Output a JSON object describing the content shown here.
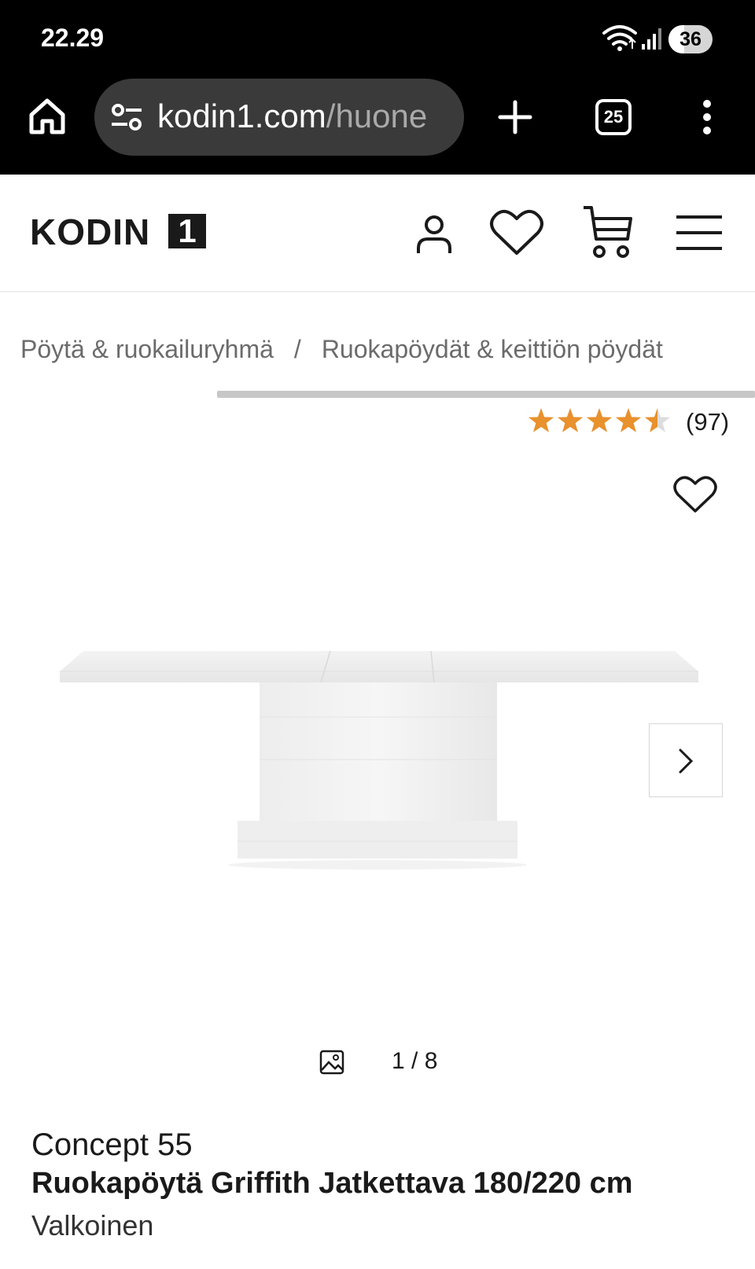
{
  "status_bar": {
    "time": "22.29",
    "battery": "36",
    "battery_level": 0.36
  },
  "browser": {
    "url_domain": "kodin1.com",
    "url_path": "/huone",
    "tab_count": "25"
  },
  "site": {
    "logo_text": "KODIN",
    "logo_number": "1"
  },
  "breadcrumb": {
    "items": [
      "Pöytä & ruokailuryhmä",
      "Ruokapöydät & keittiön pöydät"
    ],
    "separator": "/"
  },
  "rating": {
    "value": 4.5,
    "max": 5,
    "count": "(97)",
    "star_color": "#e8912d"
  },
  "gallery": {
    "counter": "1 / 8"
  },
  "product": {
    "brand": "Concept 55",
    "title": "Ruokapöytä Griffith Jatkettava 180/220 cm",
    "variant": "Valkoinen"
  },
  "icons": [
    "home-icon",
    "tune-icon",
    "plus-icon",
    "tabs-icon",
    "more-vert-icon",
    "user-icon",
    "heart-icon",
    "cart-icon",
    "menu-icon",
    "star-icon",
    "chevron-right-icon",
    "image-icon"
  ]
}
